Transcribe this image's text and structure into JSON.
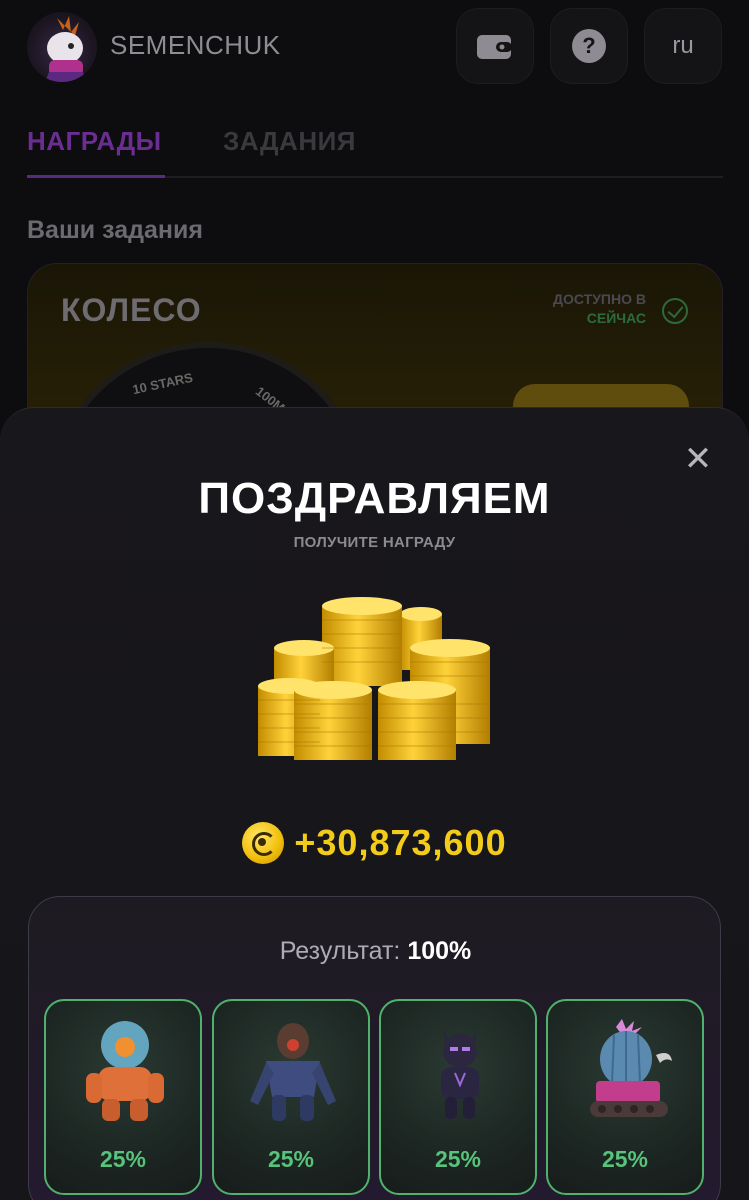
{
  "header": {
    "username": "SEMENCHUK",
    "wallet_icon": "wallet-icon",
    "help_icon": "question-icon",
    "language": "ru"
  },
  "tabs": [
    {
      "label": "НАГРАДЫ",
      "active": true
    },
    {
      "label": "ЗАДАНИЯ",
      "active": false
    }
  ],
  "section_title": "Ваши задания",
  "wheel_card": {
    "title": "КОЛЕСО",
    "availability_line1": "ДОСТУПНО В",
    "availability_line2": "СЕЙЧАС",
    "segment_labels": [
      "10 STARS",
      "100M"
    ]
  },
  "modal": {
    "title": "ПОЗДРАВЛЯЕМ",
    "subtitle": "ПОЛУЧИТЕ НАГРАДУ",
    "close_icon": "close-icon",
    "reward_amount": "+30,873,600",
    "result_label": "Результат:",
    "result_value": "100%",
    "heroes": [
      {
        "name": "robot-hero",
        "percent": "25%"
      },
      {
        "name": "beast-hero",
        "percent": "25%"
      },
      {
        "name": "panther-hero",
        "percent": "25%"
      },
      {
        "name": "cactus-tank-hero",
        "percent": "25%"
      }
    ]
  },
  "colors": {
    "accent_purple": "#6a2d92",
    "coin_gold": "#f3cb19",
    "success_green": "#58c37a"
  }
}
